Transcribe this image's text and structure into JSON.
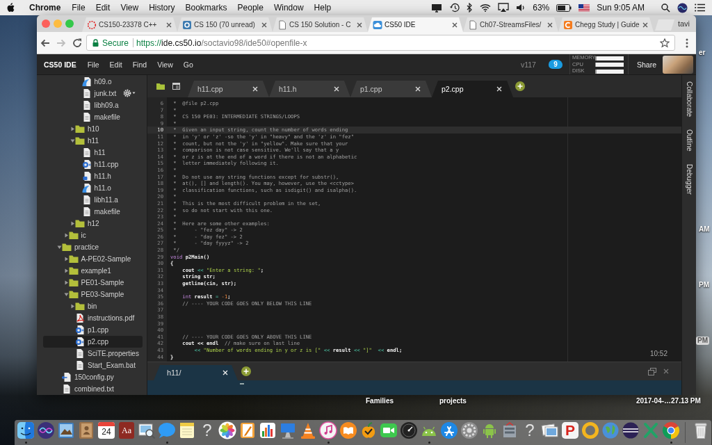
{
  "menubar": {
    "app": "Chrome",
    "menus": [
      "File",
      "Edit",
      "View",
      "History",
      "Bookmarks",
      "People",
      "Window",
      "Help"
    ],
    "battery": "63%",
    "clock": "Sun 9:05 AM"
  },
  "browser": {
    "tabs": [
      {
        "title": "CS150-23378 C++",
        "selected": false
      },
      {
        "title": "CS 150 (70 unread)",
        "selected": false
      },
      {
        "title": "CS 150 Solution - C",
        "selected": false
      },
      {
        "title": "CS50 IDE",
        "selected": true
      },
      {
        "title": "Ch07-StreamsFiles/",
        "selected": false
      },
      {
        "title": "Chegg Study | Guide",
        "selected": false
      }
    ],
    "profile": "tavi",
    "address": {
      "security": "Secure",
      "scheme": "https://",
      "host": "ide.cs50.io",
      "path": "/soctavio98/ide50#openfile-x"
    }
  },
  "ide": {
    "brand": "CS50 IDE",
    "menus": [
      "File",
      "Edit",
      "Find",
      "View",
      "Go"
    ],
    "version": "v117",
    "badge": "9",
    "meters": [
      {
        "label": "MEMORY",
        "level": 0.04
      },
      {
        "label": "CPU",
        "level": 0.03
      },
      {
        "label": "DISK",
        "level": 0.05
      }
    ],
    "share": "Share",
    "tree": [
      {
        "children": [
          {
            "children": [
              {
                "children": [
                  {
                    "label": "h09.o",
                    "kind": "object",
                    "selected": false
                  },
                  {
                    "label": "junk.txt",
                    "kind": "text",
                    "selected": false
                  },
                  {
                    "label": "libh09.a",
                    "kind": "text",
                    "selected": false
                  },
                  {
                    "label": "makefile",
                    "kind": "text",
                    "selected": false
                  }
                ]
              },
              {
                "label": "h10",
                "kind": "folder",
                "expanded": false,
                "selected": false
              },
              {
                "label": "h11",
                "kind": "folder",
                "expanded": true,
                "selected": false,
                "children": [
                  {
                    "label": "h11",
                    "kind": "text",
                    "selected": false
                  },
                  {
                    "label": "h11.cpp",
                    "kind": "cpp",
                    "selected": false
                  },
                  {
                    "label": "h11.h",
                    "kind": "header",
                    "selected": false
                  },
                  {
                    "label": "h11.o",
                    "kind": "object",
                    "selected": false
                  },
                  {
                    "label": "libh11.a",
                    "kind": "text",
                    "selected": false
                  },
                  {
                    "label": "makefile",
                    "kind": "text",
                    "selected": false
                  }
                ]
              },
              {
                "label": "h12",
                "kind": "folder",
                "expanded": false,
                "selected": false
              }
            ]
          },
          {
            "label": "ic",
            "kind": "folder",
            "expanded": false,
            "selected": false
          }
        ]
      },
      {
        "label": "practice",
        "kind": "folder",
        "expanded": true,
        "selected": false,
        "children": [
          {
            "label": "A-PE02-Sample",
            "kind": "folder",
            "expanded": false,
            "selected": false
          },
          {
            "label": "example1",
            "kind": "folder",
            "expanded": false,
            "selected": false
          },
          {
            "label": "PE01-Sample",
            "kind": "folder",
            "expanded": false,
            "selected": false
          },
          {
            "label": "PE03-Sample",
            "kind": "folder",
            "expanded": true,
            "selected": false,
            "children": [
              {
                "label": "bin",
                "kind": "folder",
                "expanded": false,
                "selected": false
              },
              {
                "label": "instructions.pdf",
                "kind": "pdf",
                "selected": false
              },
              {
                "label": "p1.cpp",
                "kind": "cpp",
                "selected": false
              },
              {
                "label": "p2.cpp",
                "kind": "cpp",
                "selected": true
              },
              {
                "label": "SciTE.properties",
                "kind": "text",
                "selected": false
              },
              {
                "label": "Start_Exam.bat",
                "kind": "text",
                "selected": false
              }
            ]
          }
        ]
      },
      {
        "label": "150config.py",
        "kind": "python",
        "selected": false
      },
      {
        "label": "combined.txt",
        "kind": "text",
        "selected": false
      }
    ],
    "editor_tabs": [
      {
        "title": "h11.cpp",
        "selected": false
      },
      {
        "title": "h11.h",
        "selected": false
      },
      {
        "title": "p1.cpp",
        "selected": false
      },
      {
        "title": "p2.cpp",
        "selected": true
      }
    ],
    "code": [
      {
        "number": "6",
        "active": false,
        "tokens": [
          {
            "kind": "comment",
            "text": " *  @file p2.cpp"
          }
        ]
      },
      {
        "number": "7",
        "active": false,
        "tokens": [
          {
            "kind": "comment",
            "text": " *"
          }
        ]
      },
      {
        "number": "8",
        "active": false,
        "tokens": [
          {
            "kind": "comment",
            "text": " *  CS 150 PE03: INTERMEDIATE STRINGS/LOOPS"
          }
        ]
      },
      {
        "number": "9",
        "active": false,
        "tokens": [
          {
            "kind": "comment",
            "text": " *"
          }
        ]
      },
      {
        "number": "10",
        "active": true,
        "tokens": [
          {
            "kind": "comment",
            "text": " *  Given an input string, count the number of words ending"
          }
        ]
      },
      {
        "number": "11",
        "active": false,
        "tokens": [
          {
            "kind": "comment",
            "text": " *  in 'y' or 'z' -so the 'y' in \"heavy\" and the 'z' in \"fez\""
          }
        ]
      },
      {
        "number": "12",
        "active": false,
        "tokens": [
          {
            "kind": "comment",
            "text": " *  count, but not the 'y' in \"yellow\". Make sure that your"
          }
        ]
      },
      {
        "number": "13",
        "active": false,
        "tokens": [
          {
            "kind": "comment",
            "text": " *  comparison is not case sensitive. We'll say that a y"
          }
        ]
      },
      {
        "number": "14",
        "active": false,
        "tokens": [
          {
            "kind": "comment",
            "text": " *  or z is at the end of a word if there is not an alphabetic"
          }
        ]
      },
      {
        "number": "15",
        "active": false,
        "tokens": [
          {
            "kind": "comment",
            "text": " *  letter immediately following it."
          }
        ]
      },
      {
        "number": "16",
        "active": false,
        "tokens": [
          {
            "kind": "comment",
            "text": " *"
          }
        ]
      },
      {
        "number": "17",
        "active": false,
        "tokens": [
          {
            "kind": "comment",
            "text": " *  Do not use any string functions except for substr(),"
          }
        ]
      },
      {
        "number": "18",
        "active": false,
        "tokens": [
          {
            "kind": "comment",
            "text": " *  at(), [] and length(). You may, however, use the <cctype>"
          }
        ]
      },
      {
        "number": "19",
        "active": false,
        "tokens": [
          {
            "kind": "comment",
            "text": " *  classification functions, such as isdigit() and isalpha()."
          }
        ]
      },
      {
        "number": "20",
        "active": false,
        "tokens": [
          {
            "kind": "comment",
            "text": " *"
          }
        ]
      },
      {
        "number": "21",
        "active": false,
        "tokens": [
          {
            "kind": "comment",
            "text": " *  This is the most difficult problem in the set,"
          }
        ]
      },
      {
        "number": "22",
        "active": false,
        "tokens": [
          {
            "kind": "comment",
            "text": " *  so do not start with this one."
          }
        ]
      },
      {
        "number": "23",
        "active": false,
        "tokens": [
          {
            "kind": "comment",
            "text": " *"
          }
        ]
      },
      {
        "number": "24",
        "active": false,
        "tokens": [
          {
            "kind": "comment",
            "text": " *  Here are some other examples:"
          }
        ]
      },
      {
        "number": "25",
        "active": false,
        "tokens": [
          {
            "kind": "comment",
            "text": " *      - \"fez day\" -> 2"
          }
        ]
      },
      {
        "number": "26",
        "active": false,
        "tokens": [
          {
            "kind": "comment",
            "text": " *      - \"day fez\" -> 2"
          }
        ]
      },
      {
        "number": "27",
        "active": false,
        "tokens": [
          {
            "kind": "comment",
            "text": " *      - \"day fyyyz\" -> 2"
          }
        ]
      },
      {
        "number": "28",
        "active": false,
        "tokens": [
          {
            "kind": "comment",
            "text": " */"
          }
        ]
      },
      {
        "number": "29",
        "active": false,
        "tokens": [
          {
            "kind": "keyword",
            "text": "void"
          },
          {
            "kind": "name",
            "text": " p2Main()"
          }
        ]
      },
      {
        "number": "30",
        "active": false,
        "tokens": [
          {
            "kind": "name",
            "text": "{"
          }
        ]
      },
      {
        "number": "31",
        "active": false,
        "tokens": [
          {
            "kind": "name",
            "text": "    cout"
          },
          {
            "kind": "operator",
            "text": " <<"
          },
          {
            "kind": "string",
            "text": " \"Enter a string: \""
          },
          {
            "kind": "name",
            "text": ";"
          }
        ]
      },
      {
        "number": "32",
        "active": false,
        "tokens": [
          {
            "kind": "name",
            "text": "    string str;"
          }
        ]
      },
      {
        "number": "33",
        "active": false,
        "tokens": [
          {
            "kind": "name",
            "text": "    getline(cin, str);"
          }
        ]
      },
      {
        "number": "34",
        "active": false
      },
      {
        "number": "35",
        "active": false,
        "tokens": [
          {
            "kind": "keyword",
            "text": "    int"
          },
          {
            "kind": "name",
            "text": " result"
          },
          {
            "kind": "operator",
            "text": " ="
          },
          {
            "kind": "number",
            "text": " -1"
          },
          {
            "kind": "name",
            "text": ";"
          }
        ]
      },
      {
        "number": "36",
        "active": false,
        "tokens": [
          {
            "kind": "comment",
            "text": "    // ---- YOUR CODE GOES ONLY BELOW THIS LINE"
          }
        ]
      },
      {
        "number": "37",
        "active": false
      },
      {
        "number": "38",
        "active": false
      },
      {
        "number": "39",
        "active": false
      },
      {
        "number": "40",
        "active": false
      },
      {
        "number": "41",
        "active": false,
        "tokens": [
          {
            "kind": "comment",
            "text": "    // ---- YOUR CODE GOES ONLY ABOVE THIS LINE"
          }
        ]
      },
      {
        "number": "42",
        "active": false,
        "tokens": [
          {
            "kind": "name",
            "text": "    cout << endl"
          },
          {
            "kind": "comment",
            "text": "  // make sure on last line"
          }
        ]
      },
      {
        "number": "43",
        "active": false,
        "tokens": [
          {
            "kind": "operator",
            "text": "        <<"
          },
          {
            "kind": "string",
            "text": " \"Number of words ending in y or z is [\""
          },
          {
            "kind": "operator",
            "text": " <<"
          },
          {
            "kind": "name",
            "text": " result"
          },
          {
            "kind": "operator",
            "text": " <<"
          },
          {
            "kind": "string",
            "text": " \"]\""
          },
          {
            "kind": "operator",
            "text": "  <<"
          },
          {
            "kind": "name",
            "text": " endl;"
          }
        ]
      },
      {
        "number": "44",
        "active": false,
        "tokens": [
          {
            "kind": "name",
            "text": "}"
          }
        ]
      }
    ],
    "cursor_position": "10:52",
    "console_tabs": [
      {
        "title": "h11/",
        "selected": true
      }
    ],
    "side_tabs": [
      "Collaborate",
      "Outline",
      "Debugger"
    ]
  },
  "desktop": {
    "labels": [
      {
        "text": "er",
        "selected": false
      },
      {
        "text": "AM",
        "selected": false
      },
      {
        "text": "PM",
        "selected": false
      },
      {
        "text": "PM",
        "selected": true
      },
      {
        "text": "Families",
        "selected": false
      },
      {
        "text": "projects",
        "selected": false
      },
      {
        "text": "2017-04-…27.13 PM",
        "selected": false
      }
    ]
  },
  "dock": {
    "items": [
      {
        "kind": "finder",
        "running": true
      },
      {
        "kind": "orb",
        "running": false
      },
      {
        "kind": "stamp",
        "running": false
      },
      {
        "kind": "contacts",
        "running": false
      },
      {
        "kind": "calendar",
        "text": "24",
        "running": false
      },
      {
        "kind": "dictionary",
        "text": "Aa",
        "running": false
      },
      {
        "kind": "preview",
        "running": false
      },
      {
        "kind": "messages",
        "running": true
      },
      {
        "kind": "notes",
        "running": false
      },
      {
        "kind": "unknown",
        "text": "?",
        "running": false
      },
      {
        "kind": "photos",
        "running": false
      },
      {
        "kind": "pages",
        "running": false
      },
      {
        "kind": "numbers",
        "running": false
      },
      {
        "kind": "keynote",
        "running": false
      },
      {
        "kind": "cone",
        "running": false
      },
      {
        "kind": "music",
        "running": true
      },
      {
        "kind": "books",
        "running": false
      },
      {
        "kind": "fruit",
        "running": false
      },
      {
        "kind": "facetime",
        "running": false
      },
      {
        "kind": "gauge",
        "running": false
      },
      {
        "kind": "robothead",
        "running": true
      },
      {
        "kind": "store",
        "running": false
      },
      {
        "kind": "gear",
        "running": false
      },
      {
        "kind": "robot",
        "running": false
      },
      {
        "kind": "toolbox",
        "running": false
      },
      {
        "kind": "unknown",
        "text": "?",
        "running": false
      },
      {
        "kind": "photostack",
        "running": false
      },
      {
        "kind": "letter",
        "text": "P",
        "running": false
      },
      {
        "kind": "ring",
        "running": false
      },
      {
        "kind": "globe",
        "running": false
      },
      {
        "kind": "eclipse",
        "running": false
      },
      {
        "kind": "cross",
        "running": false
      },
      {
        "kind": "wheel",
        "running": true
      },
      {
        "kind": "trash",
        "running": false
      }
    ]
  }
}
